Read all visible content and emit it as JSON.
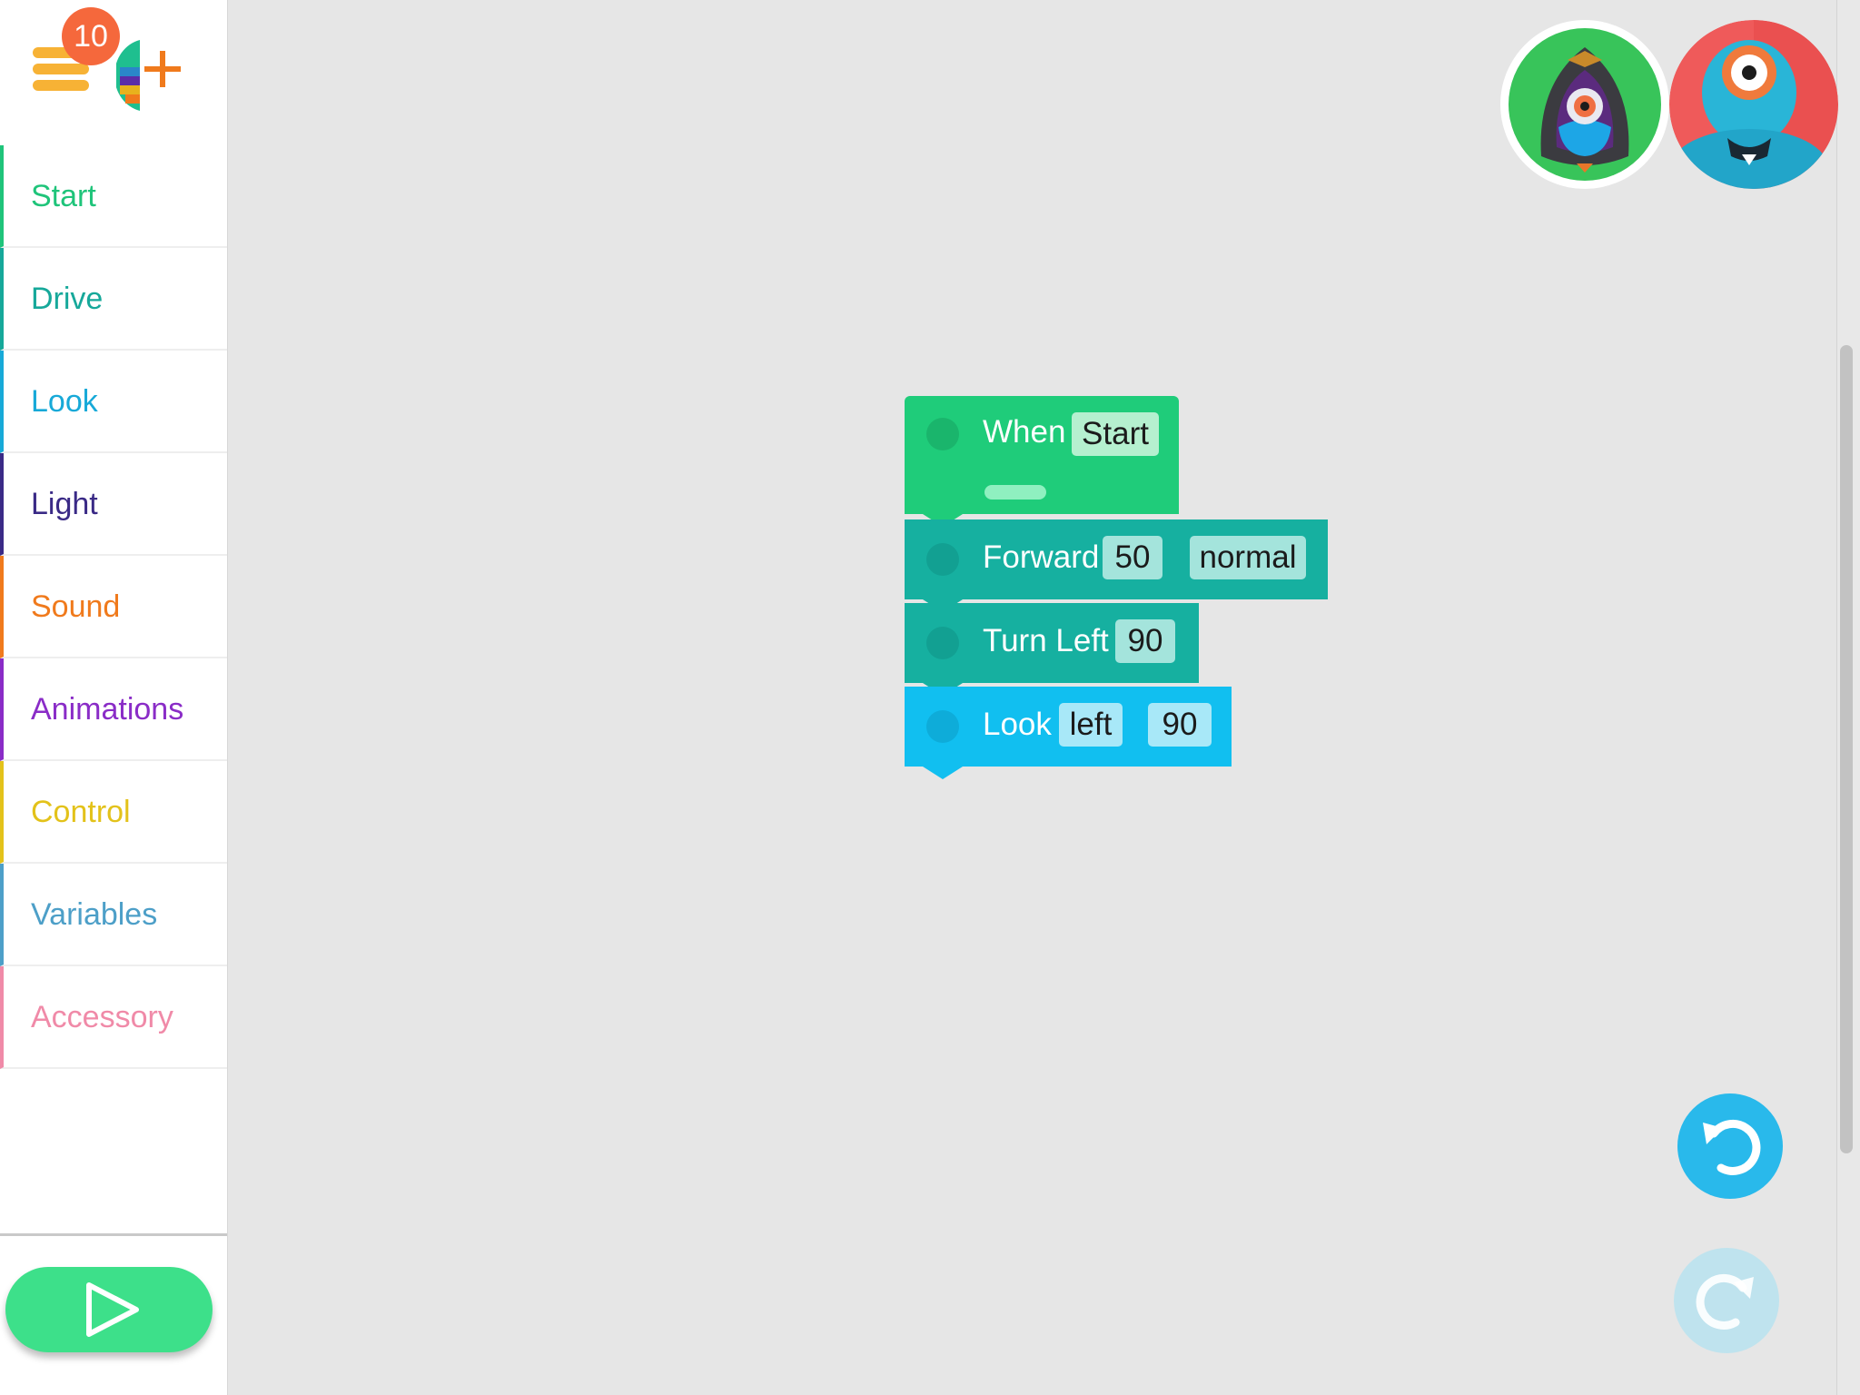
{
  "sidebar": {
    "notification_count": "10",
    "categories": [
      {
        "label": "Start",
        "color": "#1fc47a"
      },
      {
        "label": "Drive",
        "color": "#16a89a"
      },
      {
        "label": "Look",
        "color": "#17a9d8"
      },
      {
        "label": "Light",
        "color": "#3a2a86"
      },
      {
        "label": "Sound",
        "color": "#f07a1c"
      },
      {
        "label": "Animations",
        "color": "#8a2cc7"
      },
      {
        "label": "Control",
        "color": "#e3c21a"
      },
      {
        "label": "Variables",
        "color": "#4d9fc8"
      },
      {
        "label": "Accessory",
        "color": "#f08aa8"
      }
    ],
    "play_icon": "play-icon"
  },
  "robots": [
    "robot-avatar-dash-hooded",
    "robot-avatar-dash"
  ],
  "program": {
    "when": {
      "label": "When",
      "param": "Start",
      "color": "#1fcc7a"
    },
    "forward": {
      "label": "Forward",
      "distance": "50",
      "speed": "normal",
      "color": "#16b0a0"
    },
    "turn": {
      "label": "Turn Left",
      "angle": "90",
      "color": "#16b0a0"
    },
    "look": {
      "label": "Look",
      "direction": "left",
      "angle": "90",
      "color": "#11bff0"
    }
  },
  "controls": {
    "undo_icon": "undo-icon",
    "redo_icon": "redo-icon"
  }
}
